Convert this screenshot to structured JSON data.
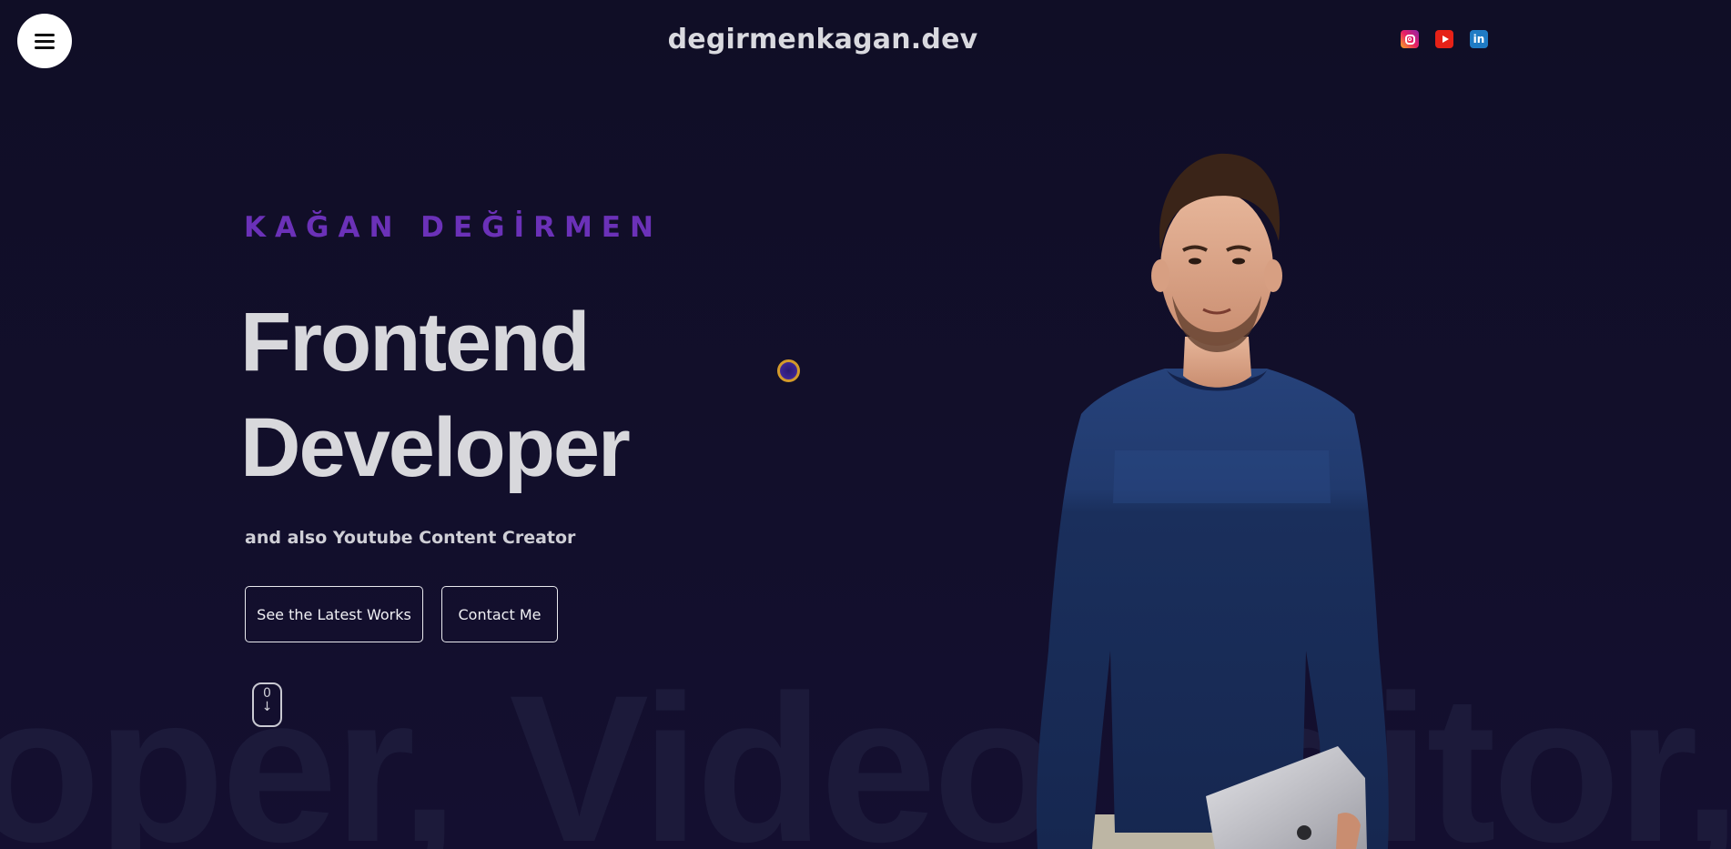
{
  "header": {
    "site_title": "degirmenkagan.dev",
    "menu_icon": "hamburger-icon",
    "social": [
      {
        "name": "instagram",
        "icon": "instagram-icon",
        "color": "#e91e63"
      },
      {
        "name": "youtube",
        "icon": "youtube-icon",
        "color": "#e62117"
      },
      {
        "name": "linkedin",
        "icon": "linkedin-icon",
        "color": "#1f7bc4",
        "glyph": "in"
      }
    ]
  },
  "hero": {
    "eyebrow": "KAĞAN DEĞİRMEN",
    "headline_line1": "Frontend",
    "headline_line2": "Developer",
    "subline": "and also Youtube Content Creator",
    "primary_button": "See the Latest Works",
    "secondary_button": "Contact Me",
    "scroll_indicator_top": "0",
    "scroll_indicator_arrow": "↓",
    "accent_color": "#6b31b8"
  },
  "background": {
    "marquee_text": "oper, Video Editor, Pl"
  }
}
